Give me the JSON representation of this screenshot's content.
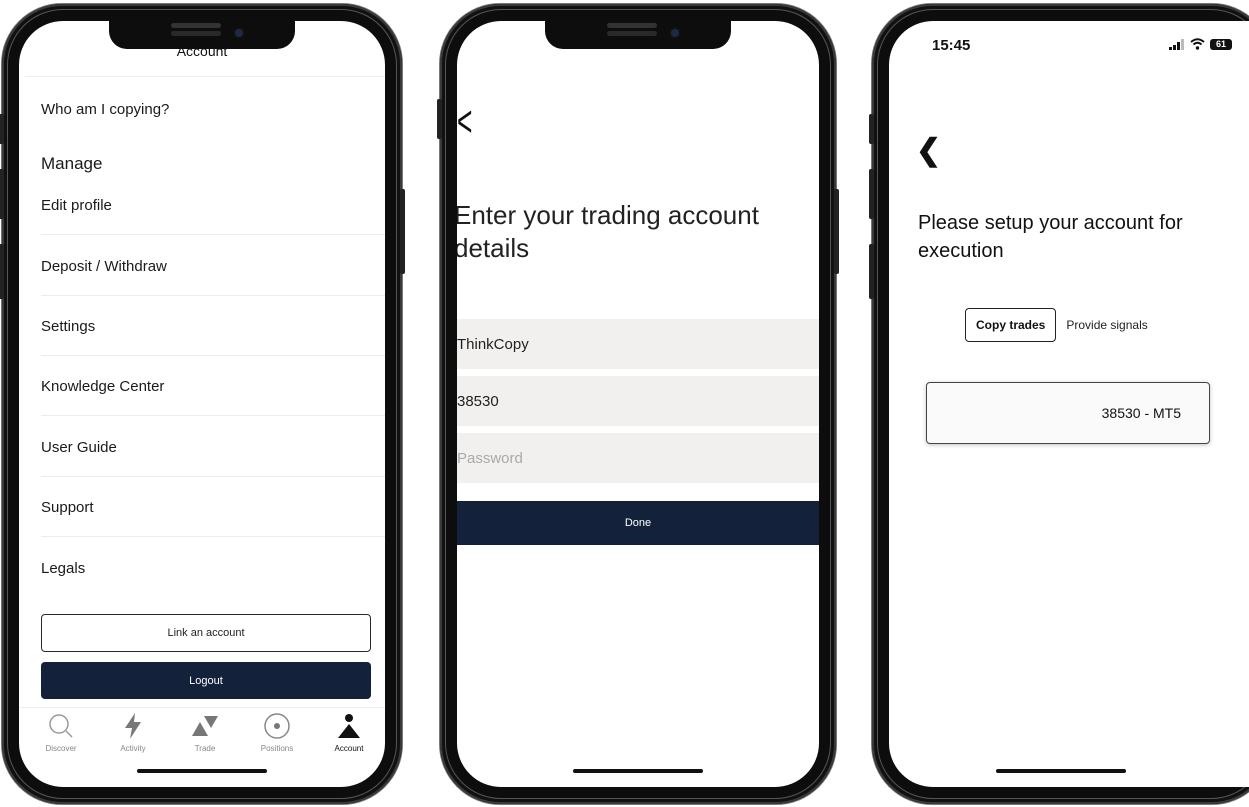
{
  "phone1": {
    "title": "Account",
    "menu": [
      {
        "label": "Who am I copying?"
      },
      {
        "label": "Edit profile"
      },
      {
        "label": "Deposit / Withdraw"
      },
      {
        "label": "Settings"
      },
      {
        "label": "Knowledge Center"
      },
      {
        "label": "User Guide"
      },
      {
        "label": "Support"
      },
      {
        "label": "Legals"
      }
    ],
    "section_manage": "Manage",
    "link_account_label": "Link an account",
    "logout_label": "Logout",
    "tabs": [
      {
        "label": "Discover",
        "icon": "search-icon"
      },
      {
        "label": "Activity",
        "icon": "lightning-icon"
      },
      {
        "label": "Trade",
        "icon": "trade-arrows-icon"
      },
      {
        "label": "Positions",
        "icon": "target-icon"
      },
      {
        "label": "Account",
        "icon": "person-icon",
        "active": true
      }
    ]
  },
  "phone2": {
    "back_glyph": "<",
    "heading": "Enter your trading account details",
    "server_value": "ThinkCopy",
    "account_value": "38530",
    "password_placeholder": "Password",
    "done_label": "Done"
  },
  "phone3": {
    "time": "15:45",
    "battery": "61",
    "back_glyph": "❮",
    "heading": "Please setup your account for execution",
    "toggle_active": "Copy trades",
    "toggle_inactive": "Provide signals",
    "account_card": "38530 - MT5"
  },
  "colors": {
    "navy": "#14213a",
    "field_bg": "#f1f0ee"
  }
}
